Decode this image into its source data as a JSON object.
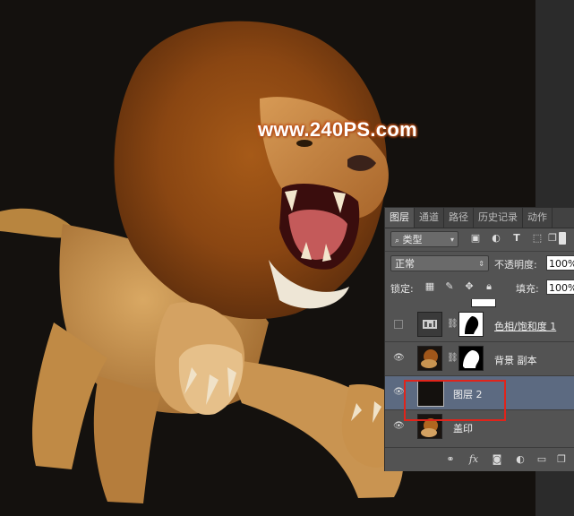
{
  "watermark": "www.240PS.com",
  "panel": {
    "tabs": [
      "图层",
      "通道",
      "路径",
      "历史记录",
      "动作"
    ],
    "active_tab": 0,
    "filter": {
      "label": "类型"
    },
    "blend": {
      "mode": "正常",
      "opacity_label": "不透明度:",
      "opacity_value": "100%"
    },
    "lock": {
      "label": "锁定:",
      "fill_label": "填充:",
      "fill_value": "100%"
    },
    "layers": [
      {
        "name": "色相/饱和度 1",
        "visible": false,
        "underlined": true
      },
      {
        "name": "背景 副本",
        "visible": true
      },
      {
        "name": "图层 2",
        "visible": true,
        "selected": true
      },
      {
        "name": "盖印",
        "visible": true
      }
    ],
    "bottom_icons": [
      "link-icon",
      "fx-icon",
      "mask-icon",
      "adjustment-icon",
      "group-icon",
      "new-layer-icon",
      "trash-icon"
    ]
  },
  "colors": {
    "panel_bg": "#535353",
    "selected_layer": "#5c6a81",
    "highlight": "#e0241b",
    "canvas_bg": "#14110e"
  }
}
